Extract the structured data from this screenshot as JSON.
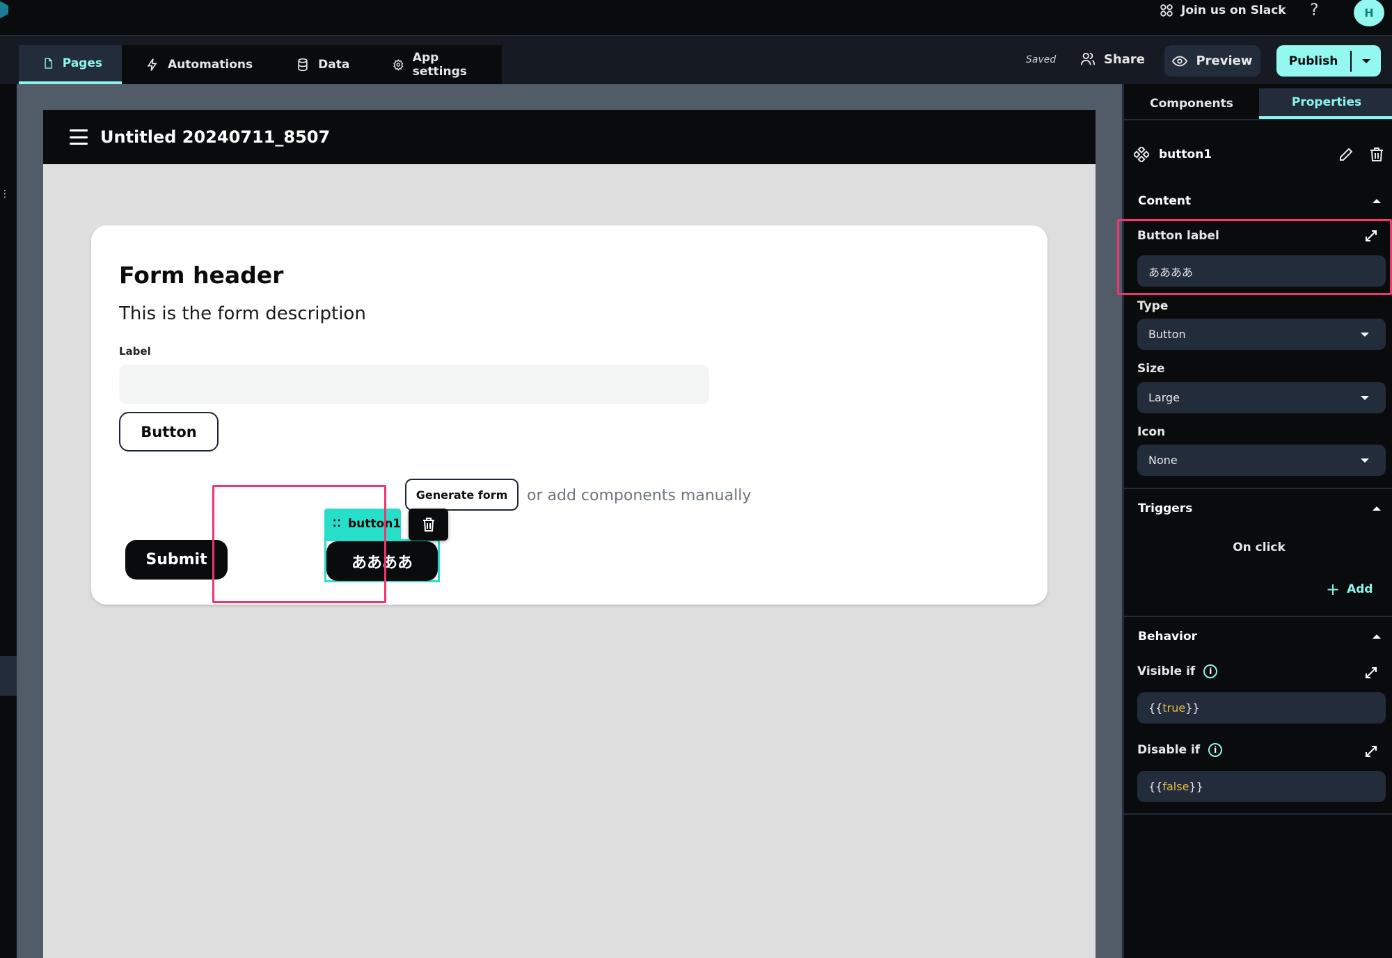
{
  "topbar": {
    "slack_label": "Join us on Slack",
    "help_label": "?",
    "avatar_initial": "H"
  },
  "toolbar": {
    "tabs": [
      {
        "label": "Pages",
        "icon": "page-icon",
        "active": true
      },
      {
        "label": "Automations",
        "icon": "lightning-icon",
        "active": false
      },
      {
        "label": "Data",
        "icon": "database-icon",
        "active": false
      },
      {
        "label": "App settings",
        "icon": "gear-icon",
        "active": false
      }
    ],
    "status": "Saved",
    "share_label": "Share",
    "preview_label": "Preview",
    "publish_label": "Publish"
  },
  "canvas": {
    "page_title": "Untitled 20240711_8507",
    "form": {
      "header": "Form header",
      "description": "This is the form description",
      "field_label": "Label",
      "field_value": "",
      "outline_button_label": "Button",
      "generate_button_label": "Generate form",
      "generate_hint": "or add components manually",
      "submit_label": "Submit",
      "selected_button_label": "ああああ",
      "selected_component_tag": "button1"
    }
  },
  "panel": {
    "tabs": [
      {
        "label": "Components",
        "active": false
      },
      {
        "label": "Properties",
        "active": true
      }
    ],
    "component_name": "button1",
    "sections": {
      "content": {
        "title": "Content",
        "button_label_title": "Button label",
        "button_label_value": "ああああ",
        "type_title": "Type",
        "type_value": "Button",
        "size_title": "Size",
        "size_value": "Large",
        "icon_title": "Icon",
        "icon_value": "None"
      },
      "triggers": {
        "title": "Triggers",
        "event": "On click",
        "add_label": "Add"
      },
      "behavior": {
        "title": "Behavior",
        "visible_if_title": "Visible if",
        "visible_if_prefix": "{{",
        "visible_if_value": "true",
        "visible_if_suffix": "}}",
        "disable_if_title": "Disable if",
        "disable_if_prefix": "{{",
        "disable_if_value": "false",
        "disable_if_suffix": "}}"
      }
    }
  },
  "colors": {
    "accent": "#92f8f0",
    "selection": "#27dec9",
    "highlight": "#f2356d",
    "keyword": "#e6b94a"
  }
}
